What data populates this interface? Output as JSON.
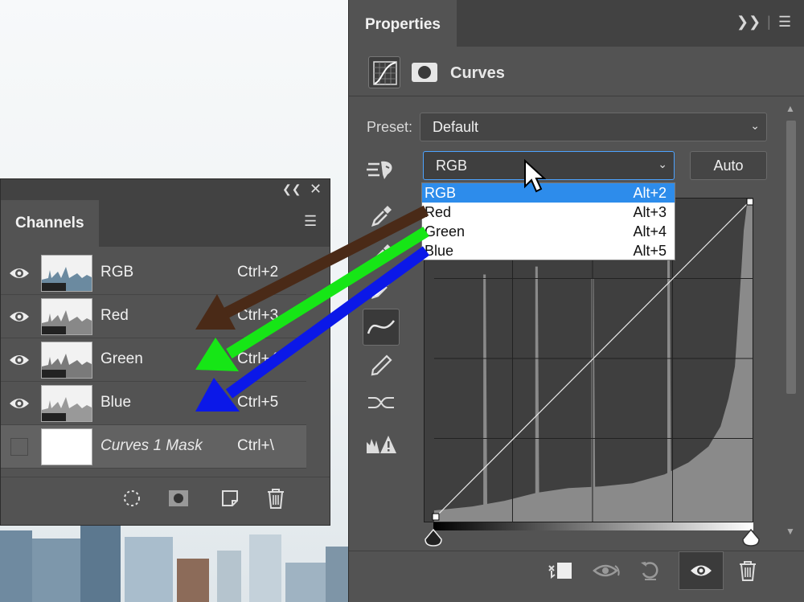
{
  "properties": {
    "tab_label": "Properties",
    "header_title": "Curves",
    "preset_label": "Preset:",
    "preset_value": "Default",
    "channel_value": "RGB",
    "auto_label": "Auto",
    "dropdown": [
      {
        "name": "RGB",
        "shortcut": "Alt+2"
      },
      {
        "name": "Red",
        "shortcut": "Alt+3"
      },
      {
        "name": "Green",
        "shortcut": "Alt+4"
      },
      {
        "name": "Blue",
        "shortcut": "Alt+5"
      }
    ]
  },
  "channels": {
    "tab_label": "Channels",
    "rows": [
      {
        "name": "RGB",
        "shortcut": "Ctrl+2"
      },
      {
        "name": "Red",
        "shortcut": "Ctrl+3"
      },
      {
        "name": "Green",
        "shortcut": "Ctrl+4"
      },
      {
        "name": "Blue",
        "shortcut": "Ctrl+5"
      },
      {
        "name": "Curves 1 Mask",
        "shortcut": "Ctrl+\\"
      }
    ]
  },
  "colors": {
    "panel": "#535353",
    "highlight": "#2d8ceb",
    "arrow_red": "#4a2a17",
    "arrow_green": "#16e616",
    "arrow_blue": "#0b18e8"
  }
}
